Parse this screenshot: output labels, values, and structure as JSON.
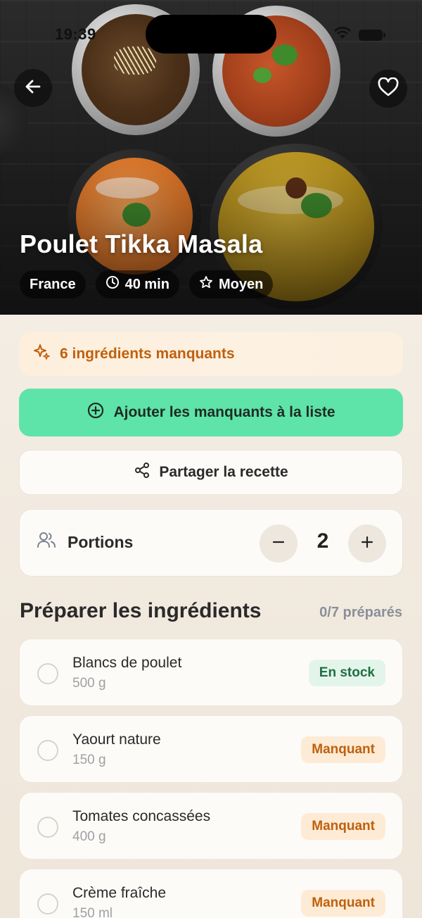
{
  "status_bar": {
    "time": "19:39"
  },
  "recipe": {
    "title": "Poulet Tikka Masala",
    "chips": [
      {
        "label": "France",
        "icon": ""
      },
      {
        "label": "40 min",
        "icon": "clock-icon"
      },
      {
        "label": "Moyen",
        "icon": "star-icon"
      }
    ]
  },
  "missing_banner": {
    "text": "6 ingrédients manquants",
    "icon": "sparkles-icon"
  },
  "actions": {
    "add_missing_label": "Ajouter les manquants à la liste",
    "share_label": "Partager la recette"
  },
  "portions": {
    "label": "Portions",
    "value": "2",
    "minus": "−",
    "plus": "+"
  },
  "ingredients_section": {
    "title": "Préparer les ingrédients",
    "progress": "0/7 préparés",
    "items": [
      {
        "name": "Blancs de poulet",
        "qty": "500 g",
        "status": "En stock",
        "kind": "stock"
      },
      {
        "name": "Yaourt nature",
        "qty": "150 g",
        "status": "Manquant",
        "kind": "missing"
      },
      {
        "name": "Tomates concassées",
        "qty": "400 g",
        "status": "Manquant",
        "kind": "missing"
      },
      {
        "name": "Crème fraîche",
        "qty": "150 ml",
        "status": "Manquant",
        "kind": "missing"
      }
    ]
  },
  "colors": {
    "accent_green": "#5ee4a9",
    "warning_orange": "#c0600d",
    "stock_green": "#1f6e43"
  }
}
